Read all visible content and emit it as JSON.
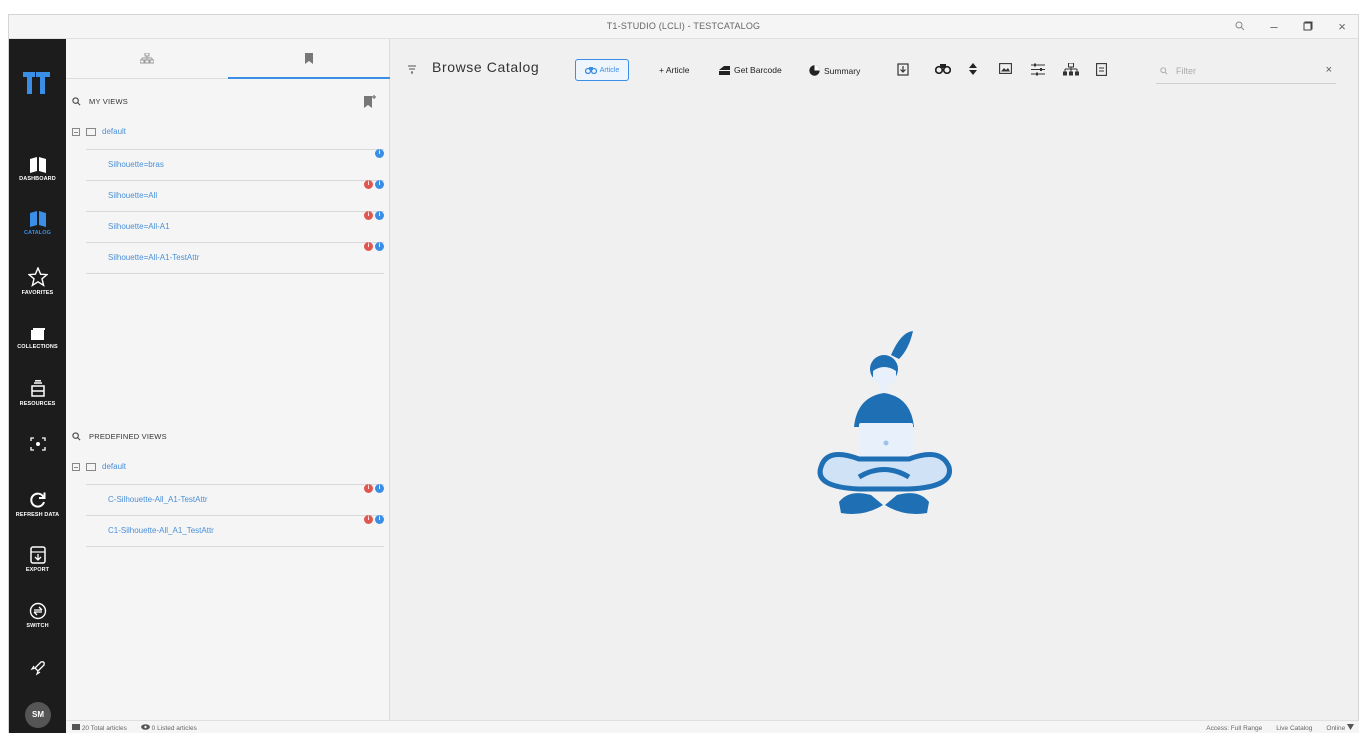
{
  "window": {
    "title": "T1-STUDIO (LCLI) - TESTCATALOG"
  },
  "nav": {
    "items": [
      {
        "label": "DASHBOARD",
        "icon": "dashboard-icon"
      },
      {
        "label": "CATALOG",
        "icon": "catalog-icon"
      },
      {
        "label": "FAVORITES",
        "icon": "star-icon"
      },
      {
        "label": "COLLECTIONS",
        "icon": "collections-icon"
      },
      {
        "label": "RESOURCES",
        "icon": "resources-icon"
      },
      {
        "label": "REFRESH DATA",
        "icon": "refresh-icon"
      },
      {
        "label": "EXPORT",
        "icon": "export-icon"
      },
      {
        "label": "SWITCH",
        "icon": "switch-icon"
      }
    ],
    "active_label": "CATALOG",
    "avatar": "SM"
  },
  "views": {
    "my_views": {
      "title": "MY VIEWS",
      "group": "default",
      "items": [
        {
          "name": "Silhouette=bras",
          "red": "",
          "blue": "i"
        },
        {
          "name": "Silhouette=All",
          "red": "i",
          "blue": "i"
        },
        {
          "name": "Silhouette=All-A1",
          "red": "i",
          "blue": "i"
        },
        {
          "name": "Silhouette=All-A1-TestAttr",
          "red": "i",
          "blue": "i"
        }
      ]
    },
    "predefined_views": {
      "title": "PREDEFINED VIEWS",
      "group": "default",
      "items": [
        {
          "name": "C-Silhouette-All_A1-TestAttr",
          "red": "i",
          "blue": "i"
        },
        {
          "name": "C1-Silhouette-All_A1_TestAttr",
          "red": "i",
          "blue": "i"
        }
      ]
    }
  },
  "toolbar": {
    "title": "Browse Catalog",
    "article_chip": "Article",
    "add_article": "+ Article",
    "get_barcode": "Get Barcode",
    "summary": "Summary",
    "filter_placeholder": "Filter"
  },
  "status": {
    "total_articles": "20 Total articles",
    "listed_articles": "0 Listed articles",
    "access": "Access: Full Range",
    "catalog": "Live Catalog",
    "online": "Online"
  },
  "colors": {
    "accent": "#3a8ee6",
    "nav_bg": "#1c1c1c",
    "badge_red": "#e0574f"
  }
}
